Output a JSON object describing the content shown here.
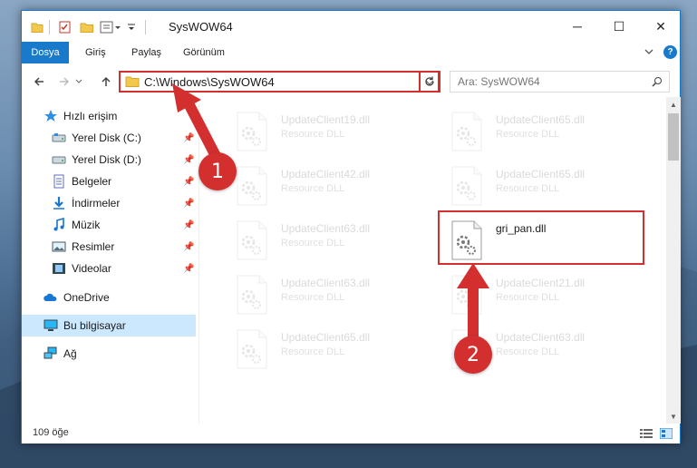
{
  "window": {
    "title": "SysWOW64",
    "controls": {
      "minimize": "─",
      "maximize": "☐",
      "close": "✕"
    }
  },
  "ribbon": {
    "tabs": [
      "Dosya",
      "Giriş",
      "Paylaş",
      "Görünüm"
    ],
    "collapse_icon": "chevron-down-icon",
    "help_label": "?"
  },
  "nav": {
    "address": "C:\\Windows\\SysWOW64",
    "search_placeholder": "Ara: SysWOW64"
  },
  "sidebar": {
    "quick_access": "Hızlı erişim",
    "pinned": [
      {
        "label": "Yerel Disk (C:)",
        "icon": "drive-icon"
      },
      {
        "label": "Yerel Disk (D:)",
        "icon": "drive-icon"
      },
      {
        "label": "Belgeler",
        "icon": "documents-icon"
      },
      {
        "label": "İndirmeler",
        "icon": "downloads-icon"
      },
      {
        "label": "Müzik",
        "icon": "music-icon"
      },
      {
        "label": "Resimler",
        "icon": "pictures-icon"
      },
      {
        "label": "Videolar",
        "icon": "videos-icon"
      }
    ],
    "onedrive": "OneDrive",
    "this_pc": "Bu bilgisayar",
    "network": "Ağ"
  },
  "files": [
    {
      "name": "UpdateClient19.dll",
      "type": "Resource DLL",
      "faded": true
    },
    {
      "name": "UpdateClient65.dll",
      "type": "Resource DLL",
      "faded": true
    },
    {
      "name": "UpdateClient42.dll",
      "type": "Resource DLL",
      "faded": true
    },
    {
      "name": "UpdateClient65.dll",
      "type": "Resource DLL",
      "faded": true
    },
    {
      "name": "UpdateClient63.dll",
      "type": "Resource DLL",
      "faded": true
    },
    {
      "name": "gri_pan.dll",
      "type": "",
      "faded": false
    },
    {
      "name": "UpdateClient63.dll",
      "type": "Resource DLL",
      "faded": true
    },
    {
      "name": "UpdateClient21.dll",
      "type": "Resource DLL",
      "faded": true
    },
    {
      "name": "UpdateClient65.dll",
      "type": "Resource DLL",
      "faded": true
    },
    {
      "name": "UpdateClient63.dll",
      "type": "Resource DLL",
      "faded": true
    }
  ],
  "status": {
    "count": "109 öğe"
  },
  "callouts": [
    "1",
    "2"
  ],
  "colors": {
    "accent": "#1979ca",
    "highlight": "#d32f2f",
    "selection": "#cce8ff"
  }
}
